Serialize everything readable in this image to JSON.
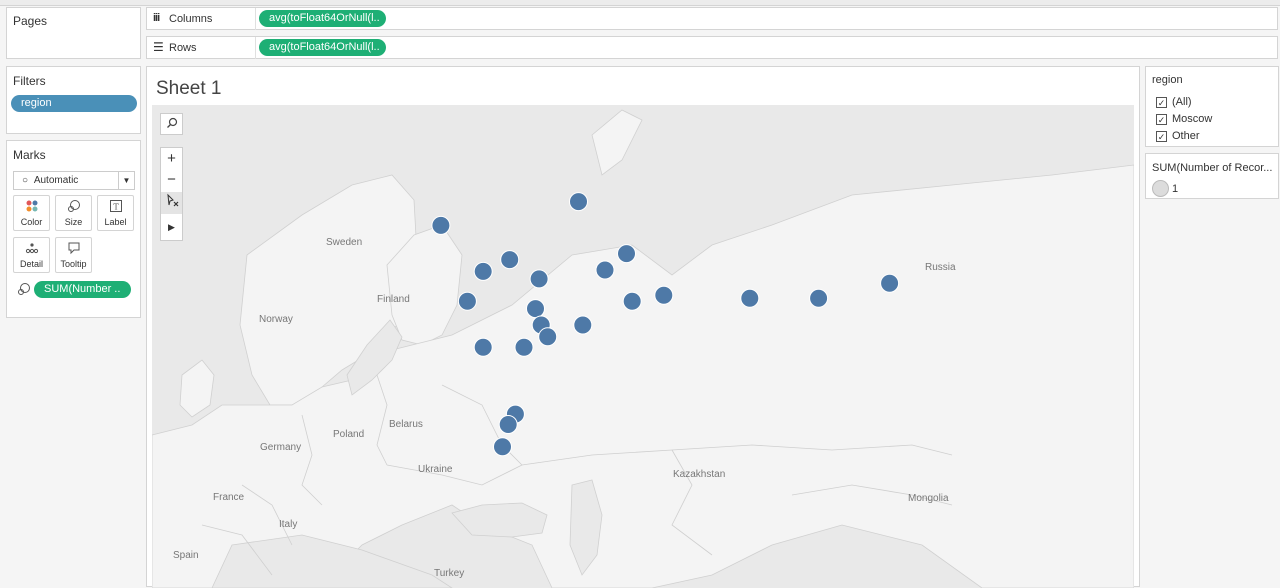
{
  "pages": {
    "title": "Pages"
  },
  "shelves": {
    "columns": {
      "label": "Columns",
      "pill": "avg(toFloat64OrNull(l.."
    },
    "rows": {
      "label": "Rows",
      "pill": "avg(toFloat64OrNull(l.."
    }
  },
  "filters": {
    "title": "Filters",
    "pill": "region"
  },
  "marks": {
    "title": "Marks",
    "type": "Automatic",
    "buttons": {
      "color": "Color",
      "size": "Size",
      "label": "Label",
      "detail": "Detail",
      "tooltip": "Tooltip"
    },
    "pill": "SUM(Number .."
  },
  "sheet": {
    "title": "Sheet 1"
  },
  "map": {
    "labels": {
      "sweden": "Sweden",
      "finland": "Finland",
      "norway": "Norway",
      "russia": "Russia",
      "belarus": "Belarus",
      "poland": "Poland",
      "germany": "Germany",
      "ukraine": "Ukraine",
      "kazakhstan": "Kazakhstan",
      "france": "France",
      "italy": "Italy",
      "mongolia": "Mongolia",
      "spain": "Spain",
      "turkey": "Turkey"
    },
    "points": [
      {
        "lon": 30.3,
        "lat": 59.9
      },
      {
        "lon": 49.5,
        "lat": 61.5
      },
      {
        "lon": 36.2,
        "lat": 56.8
      },
      {
        "lon": 39.9,
        "lat": 57.6
      },
      {
        "lon": 53.2,
        "lat": 56.9
      },
      {
        "lon": 56.2,
        "lat": 58.0
      },
      {
        "lon": 34.0,
        "lat": 54.8
      },
      {
        "lon": 44.0,
        "lat": 56.3
      },
      {
        "lon": 43.5,
        "lat": 54.3
      },
      {
        "lon": 44.3,
        "lat": 53.2
      },
      {
        "lon": 45.2,
        "lat": 52.4
      },
      {
        "lon": 50.1,
        "lat": 53.2
      },
      {
        "lon": 57.0,
        "lat": 54.8
      },
      {
        "lon": 61.4,
        "lat": 55.2
      },
      {
        "lon": 73.4,
        "lat": 55.0
      },
      {
        "lon": 83.0,
        "lat": 55.0
      },
      {
        "lon": 92.9,
        "lat": 56.0
      },
      {
        "lon": 36.2,
        "lat": 51.7
      },
      {
        "lon": 41.9,
        "lat": 51.7
      },
      {
        "lon": 40.7,
        "lat": 47.2
      },
      {
        "lon": 39.7,
        "lat": 46.5
      },
      {
        "lon": 38.9,
        "lat": 45.0
      }
    ]
  },
  "legend": {
    "region_title": "region",
    "region_items": [
      {
        "label": "(All)",
        "checked": true
      },
      {
        "label": "Moscow",
        "checked": true
      },
      {
        "label": "Other",
        "checked": true
      }
    ],
    "size_title": "SUM(Number of Recor...",
    "size_value": "1"
  },
  "colors": {
    "accent_green": "#1eaf75",
    "filter_blue": "#4a90b8",
    "mark": "#4e79a7"
  }
}
